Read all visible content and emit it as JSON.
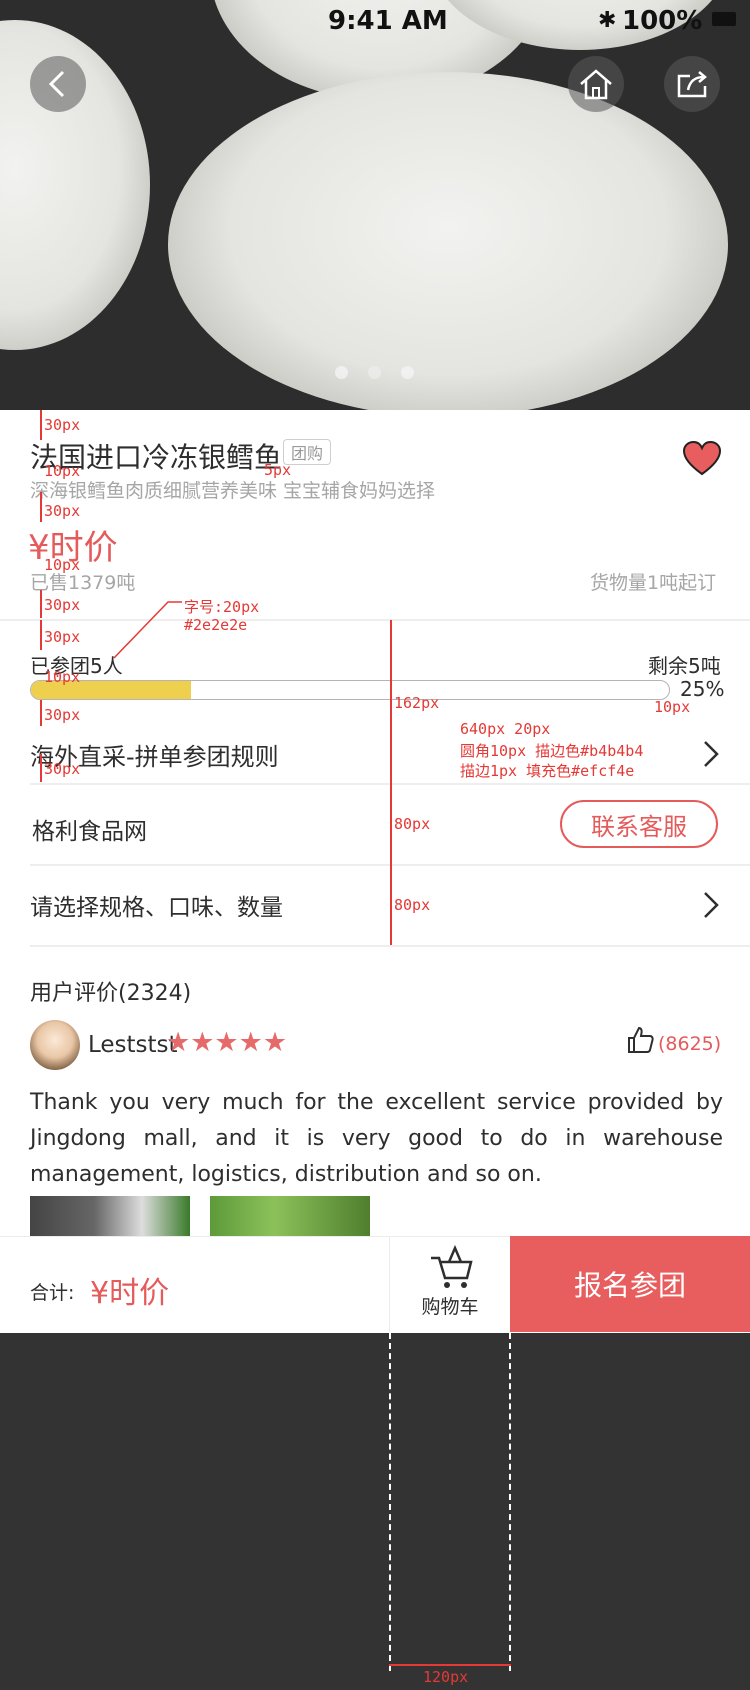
{
  "status_bar": {
    "time": "9:41 AM",
    "battery": "100%"
  },
  "product": {
    "title": "法国进口冷冻银鳕鱼",
    "tag": "团购",
    "subtitle": "深海银鳕鱼肉质细腻营养美味 宝宝辅食妈妈选择",
    "price": "¥时价",
    "sold": "已售1379吨",
    "min_order": "货物量1吨起订"
  },
  "group": {
    "joined": "已参团5人",
    "remaining": "剩余5吨",
    "progress_percent": 25,
    "progress_label": "25%",
    "rules_label": "海外直采-拼单参团规则"
  },
  "store": {
    "name": "格利食品网",
    "contact_label": "联系客服"
  },
  "spec": {
    "label": "请选择规格、口味、数量"
  },
  "reviews": {
    "heading": "用户评价(2324)",
    "user": "Leststst",
    "stars": 5,
    "likes": "(8625)",
    "text": "Thank you very much for the excellent service provided by Jingdong mall, and it is very good to do in warehouse management, logistics, distribution and so on."
  },
  "footer": {
    "total_label": "合计:",
    "total_value": "¥时价",
    "cart_label": "购物车",
    "join_label": "报名参团"
  },
  "annotations": {
    "a30": "30px",
    "a10": "10px",
    "a5": "5px",
    "font_note": "字号:20px",
    "font_color": "#2e2e2e",
    "a162": "162px",
    "bar_size": "640px  20px",
    "bar_radius": "圆角10px   描边色#b4b4b4",
    "bar_stroke": "描边1px    填充色#efcf4e",
    "a80": "80px",
    "a120": "120px"
  },
  "colors": {
    "accent": "#e55a5a",
    "progress_fill": "#efcf4e",
    "progress_stroke": "#b4b4b4",
    "annotation": "#e53935"
  },
  "icons": [
    "back-icon",
    "home-icon",
    "share-icon",
    "heart-icon",
    "chevron-right-icon",
    "thumbs-up-icon",
    "cart-icon",
    "bluetooth-icon"
  ]
}
